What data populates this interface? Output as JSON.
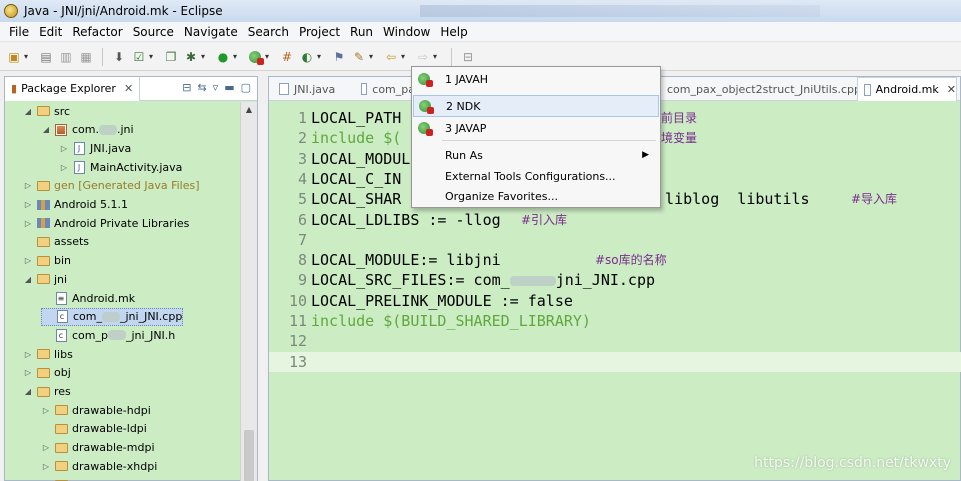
{
  "window": {
    "title": "Java - JNI/jni/Android.mk - Eclipse"
  },
  "menubar": [
    "File",
    "Edit",
    "Refactor",
    "Source",
    "Navigate",
    "Search",
    "Project",
    "Run",
    "Window",
    "Help"
  ],
  "toolbar": {
    "icons": [
      "new-icon",
      "save-icon",
      "save-all-icon",
      "print-icon",
      "android-sdk-icon",
      "checkbox-icon",
      "new-android-project-icon",
      "debug-icon",
      "run-icon",
      "external-tools-icon",
      "open-type-icon",
      "open-perspective-icon",
      "search-icon",
      "back-icon",
      "forward-icon",
      "pin-icon"
    ]
  },
  "package_explorer": {
    "title": "Package Explorer",
    "tree": [
      {
        "label": "src",
        "icon": "source-folder-icon",
        "expanded": true,
        "indent": 1
      },
      {
        "label": "com.",
        "suffix": ".jni",
        "icon": "package-icon",
        "expanded": true,
        "indent": 2
      },
      {
        "label": "JNI.java",
        "icon": "java-file-icon",
        "expanded": false,
        "indent": 3
      },
      {
        "label": "MainActivity.java",
        "icon": "java-file-icon",
        "expanded": false,
        "indent": 3
      },
      {
        "label": "gen [Generated Java Files]",
        "icon": "source-folder-icon",
        "expanded": false,
        "indent": 1,
        "style": "generated"
      },
      {
        "label": "Android 5.1.1",
        "icon": "library-icon",
        "expanded": false,
        "indent": 1
      },
      {
        "label": "Android Private Libraries",
        "icon": "library-icon",
        "expanded": false,
        "indent": 1
      },
      {
        "label": "assets",
        "icon": "folder-icon",
        "expanded": null,
        "indent": 1
      },
      {
        "label": "bin",
        "icon": "folder-icon",
        "expanded": false,
        "indent": 1
      },
      {
        "label": "jni",
        "icon": "folder-icon",
        "expanded": true,
        "indent": 1
      },
      {
        "label": "Android.mk",
        "icon": "mk-file-icon",
        "expanded": null,
        "indent": 2
      },
      {
        "label": "com_",
        "suffix": "_jni_JNI.cpp",
        "icon": "c-file-icon",
        "expanded": null,
        "indent": 2,
        "selected": true
      },
      {
        "label": "com_p",
        "suffix": "_jni_JNI.h",
        "icon": "c-file-icon",
        "expanded": null,
        "indent": 2
      },
      {
        "label": "libs",
        "icon": "folder-icon",
        "expanded": false,
        "indent": 1
      },
      {
        "label": "obj",
        "icon": "folder-icon",
        "expanded": false,
        "indent": 1
      },
      {
        "label": "res",
        "icon": "folder-icon",
        "expanded": true,
        "indent": 1
      },
      {
        "label": "drawable-hdpi",
        "icon": "folder-icon",
        "expanded": false,
        "indent": 2
      },
      {
        "label": "drawable-ldpi",
        "icon": "folder-icon",
        "expanded": null,
        "indent": 2
      },
      {
        "label": "drawable-mdpi",
        "icon": "folder-icon",
        "expanded": false,
        "indent": 2
      },
      {
        "label": "drawable-xhdpi",
        "icon": "folder-icon",
        "expanded": false,
        "indent": 2
      },
      {
        "label": "drawable-xxhdpi",
        "icon": "folder-icon",
        "expanded": false,
        "indent": 2
      }
    ]
  },
  "editor": {
    "tabs": [
      {
        "label": "JNI.java",
        "active": false
      },
      {
        "label": "com_pa",
        "active": false
      },
      {
        "label": "com_pax_object2struct_JniUtils.cpp",
        "active": false
      },
      {
        "label": "Android.mk",
        "active": true
      }
    ],
    "lines": [
      {
        "n": "1",
        "text": "LOCAL_PATH",
        "comment": "前目录",
        "kw": false
      },
      {
        "n": "2",
        "text": "include $(",
        "comment": "境变量",
        "kw": true
      },
      {
        "n": "3",
        "text": "LOCAL_MODUL",
        "comment": "",
        "kw": false
      },
      {
        "n": "4",
        "text": "LOCAL_C_IN",
        "tail": "RS)",
        "comment": "",
        "kw": false
      },
      {
        "n": "5",
        "text": "LOCAL_SHAR",
        "tail": "s liblog  libutils",
        "comment": "#导入库",
        "kw": false
      },
      {
        "n": "6",
        "text": "LOCAL_LDLIBS := -llog",
        "comment": "#引入库",
        "kw": false
      },
      {
        "n": "7",
        "text": "",
        "comment": "",
        "kw": false
      },
      {
        "n": "8",
        "text": "LOCAL_MODULE:= libjni",
        "comment": "#so库的名称",
        "kw": false
      },
      {
        "n": "9",
        "text": "LOCAL_SRC_FILES:= com_",
        "tail2": "jni_JNI.cpp",
        "comment": "",
        "kw": false
      },
      {
        "n": "10",
        "text": "LOCAL_PRELINK_MODULE := false",
        "comment": "",
        "kw": false
      },
      {
        "n": "11",
        "text": "include $(BUILD_SHARED_LIBRARY)",
        "comment": "",
        "kw": true
      },
      {
        "n": "12",
        "text": "",
        "comment": "",
        "kw": false
      },
      {
        "n": "13",
        "text": "",
        "comment": "",
        "kw": false
      }
    ]
  },
  "external_tools_menu": {
    "items": [
      {
        "label": "1 JAVAH",
        "icon": "external-tool-icon"
      },
      {
        "label": "2 NDK",
        "icon": "external-tool-icon",
        "highlighted": true
      },
      {
        "label": "3 JAVAP",
        "icon": "external-tool-icon"
      },
      {
        "label": "Run As",
        "submenu": true
      },
      {
        "label": "External Tools Configurations..."
      },
      {
        "label": "Organize Favorites..."
      }
    ]
  },
  "watermark": "https://blog.csdn.net/tkwxty"
}
